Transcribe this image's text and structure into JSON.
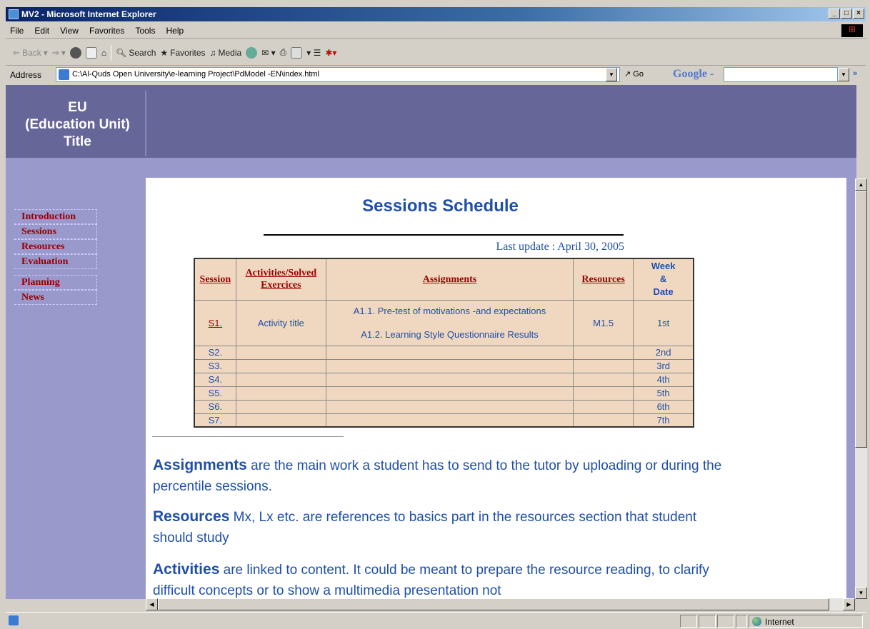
{
  "window": {
    "title": "MV2 - Microsoft Internet Explorer"
  },
  "menu": [
    "File",
    "Edit",
    "View",
    "Favorites",
    "Tools",
    "Help"
  ],
  "toolbar": {
    "back": "Back",
    "search": "Search",
    "favorites": "Favorites",
    "media": "Media"
  },
  "address": {
    "label": "Address",
    "url": "C:\\Al-Quds Open University\\e-learning Project\\PdModel -EN\\index.html",
    "go": "Go",
    "google": "Google -",
    "more": "»"
  },
  "page": {
    "eu_title": "EU\n(Education Unit)\nTitle",
    "nav": [
      "Introduction",
      "Sessions",
      "Resources",
      "Evaluation",
      "Planning",
      "News"
    ],
    "schedule_title": "Sessions Schedule",
    "last_update": "Last update : April 30, 2005",
    "table": {
      "headers": {
        "session": "Session",
        "activities": "Activities/Solved Exercices",
        "assignments": "Assignments",
        "resources": "Resources",
        "week_date": "Week & Date"
      },
      "s1": {
        "session": "S1.",
        "activity": "Activity title",
        "assignment1": "A1.1. Pre-test of motivations -and expectations",
        "assignment2": "A1.2. Learning Style Questionnaire Results",
        "resources": "M1.5",
        "week": "1st"
      },
      "rows": [
        {
          "session": "S2.",
          "week": "2nd"
        },
        {
          "session": "S3.",
          "week": "3rd"
        },
        {
          "session": "S4.",
          "week": "4th"
        },
        {
          "session": "S5.",
          "week": "5th"
        },
        {
          "session": "S6.",
          "week": "6th"
        },
        {
          "session": "S7.",
          "week": "7th"
        }
      ]
    },
    "para1": {
      "term": "Assignments",
      "text": " are the main work a student has to send to the tutor  by uploading or  during the percentile sessions."
    },
    "para2": {
      "term": "Resources",
      "text": " Mx, Lx etc. are  references to basics part in the resources section that student should study"
    },
    "para3": {
      "term": "Activities",
      "text": " are linked to content. It could be meant to prepare the resource reading, to clarify difficult concepts or to show a multimedia presentation not"
    }
  },
  "status": {
    "zone": "Internet"
  }
}
